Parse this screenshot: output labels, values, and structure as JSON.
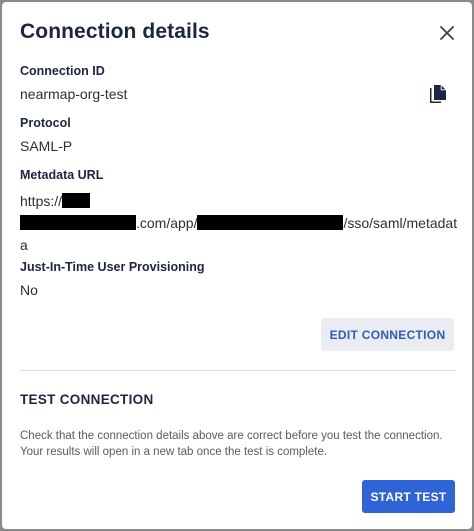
{
  "dialog": {
    "title": "Connection details",
    "close_icon": "close-icon"
  },
  "fields": {
    "connection_id": {
      "label": "Connection ID",
      "value": "nearmap-org-test",
      "copy_icon": "copy-icon"
    },
    "protocol": {
      "label": "Protocol",
      "value": "SAML-P"
    },
    "metadata_url": {
      "label": "Metadata URL",
      "part1": "https://",
      "part2": ".com/app/",
      "part3": "/sso/saml/metadat",
      "part4": "a"
    },
    "jit": {
      "label": "Just-In-Time User Provisioning",
      "value": "No"
    }
  },
  "actions": {
    "edit_label": "EDIT CONNECTION"
  },
  "test_section": {
    "title": "TEST CONNECTION",
    "description": "Check that the connection details above are correct before you test the connection. Your results will open in a new tab once the test is complete.",
    "start_label": "START TEST"
  },
  "colors": {
    "primary": "#2f64d6",
    "heading": "#1c2541",
    "secondary_button_bg": "#e9ecf1"
  }
}
